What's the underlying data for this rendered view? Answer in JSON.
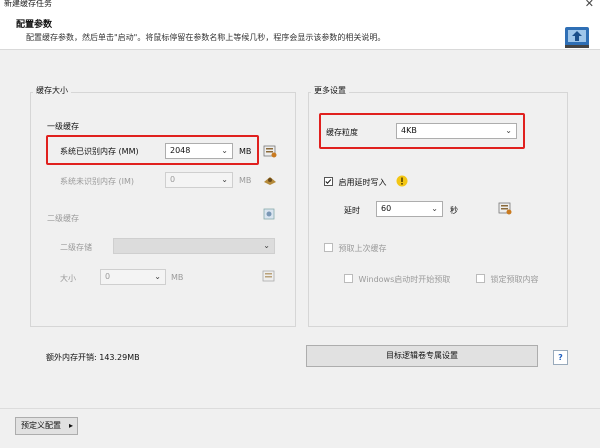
{
  "window": {
    "title": "新建缓存任务",
    "close_label": "✕"
  },
  "header": {
    "title": "配置参数",
    "description": "配置缓存参数，然后单击\"启动\"。将鼠标停留在参数名称上等候几秒，程序会显示该参数的相关说明。"
  },
  "cache_size": {
    "legend": "缓存大小",
    "level1": {
      "label": "一级缓存",
      "recognized": {
        "label": "系统已识别内存 (MM)",
        "value": "2048",
        "unit": "MB"
      },
      "unrecognized": {
        "label": "系统未识别内存 (IM)",
        "value": "0",
        "unit": "MB"
      }
    },
    "level2": {
      "label": "二级缓存",
      "storage": {
        "label": "二级存储",
        "value": ""
      },
      "size": {
        "label": "大小",
        "value": "0",
        "unit": "MB"
      }
    }
  },
  "more_settings": {
    "legend": "更多设置",
    "granularity": {
      "label": "缓存粒度",
      "value": "4KB"
    },
    "delayed_write": {
      "label": "启用延时写入",
      "checked": true
    },
    "delay": {
      "label": "延时",
      "value": "60",
      "unit": "秒"
    },
    "prefetch": {
      "label": "预取上次缓存",
      "checked": false
    },
    "startup_prefetch": {
      "label": "Windows启动时开始预取",
      "checked": false
    },
    "lock_prefetch": {
      "label": "锁定预取内容",
      "checked": false
    }
  },
  "extra_memory": "额外内存开销: 143.29MB",
  "target_volume_button": "目标逻辑卷专属设置",
  "help_label": "?",
  "preset_button": "预定义配置",
  "colors": {
    "highlight": "#e0201e",
    "help": "#1f5fbf",
    "warning": "#f3c614"
  }
}
